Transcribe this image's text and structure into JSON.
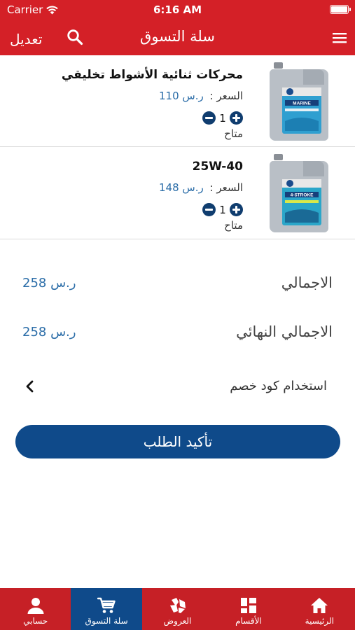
{
  "status_bar": {
    "carrier": "Carrier",
    "time": "6:16 AM"
  },
  "nav": {
    "title": "سلة التسوق",
    "edit_label": "تعديل"
  },
  "cart": {
    "items": [
      {
        "name": "محركات ثنائية الأشواط تخليقي",
        "price_label": "السعر :",
        "price_value": "ر.س 110",
        "quantity": "1",
        "availability": "متاح",
        "image_label": "MARINE"
      },
      {
        "name": "25W-40",
        "price_label": "السعر :",
        "price_value": "ر.س 148",
        "quantity": "1",
        "availability": "متاح",
        "image_label": "4-STROKE"
      }
    ]
  },
  "summary": {
    "total_label": "الاجمالي",
    "total_value": "ر.س 258",
    "final_total_label": "الاجمالي النهائي",
    "final_total_value": "ر.س 258",
    "discount_label": "استخدام كود خصم"
  },
  "confirm_label": "تأكيد الطلب",
  "tabs": [
    {
      "label": "حسابي",
      "icon": "user-icon",
      "active": false
    },
    {
      "label": "سلة التسوق",
      "icon": "cart-icon",
      "active": true
    },
    {
      "label": "العروض",
      "icon": "offers-icon",
      "active": false
    },
    {
      "label": "الأقسام",
      "icon": "categories-icon",
      "active": false
    },
    {
      "label": "الرئيسية",
      "icon": "home-icon",
      "active": false
    }
  ],
  "colors": {
    "header": "#d42027",
    "tab_bar": "#c62026",
    "accent_blue": "#0f4a8a",
    "price_blue": "#2b6da8"
  }
}
